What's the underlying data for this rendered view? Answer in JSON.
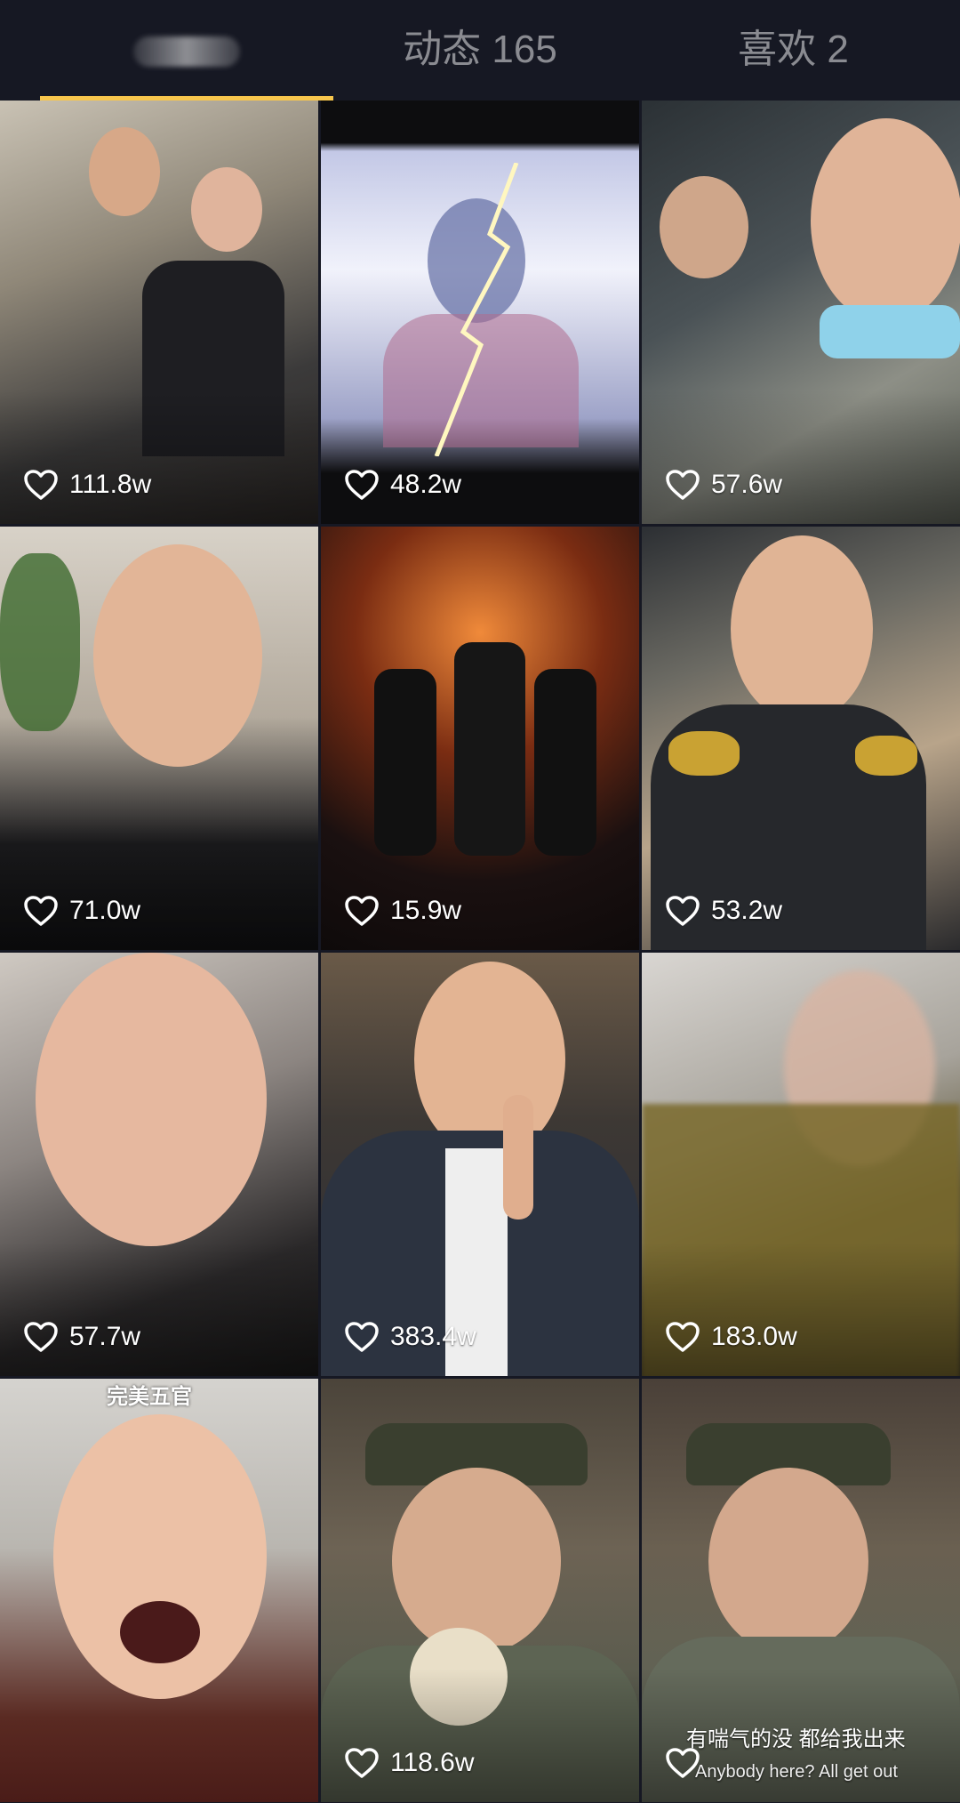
{
  "tabs": [
    {
      "label": "",
      "active": true
    },
    {
      "label": "动态 165",
      "active": false
    },
    {
      "label": "喜欢 2",
      "active": false
    }
  ],
  "colors": {
    "background": "#161823",
    "indicator": "#f7c64c",
    "inactive_tab": "#8a8b91"
  },
  "icons": {
    "like": "heart-outline-icon"
  },
  "videos": [
    {
      "likes": "111.8w"
    },
    {
      "likes": "48.2w"
    },
    {
      "likes": "57.6w"
    },
    {
      "likes": "71.0w"
    },
    {
      "likes": "15.9w"
    },
    {
      "likes": "53.2w"
    },
    {
      "likes": "57.7w"
    },
    {
      "likes": "383.4w"
    },
    {
      "likes": "183.0w"
    },
    {
      "likes": "",
      "top_caption": "完美五官"
    },
    {
      "likes": "118.6w"
    },
    {
      "likes": "",
      "caption": "有喘气的没 都给我出来",
      "caption_en": "Anybody here? All get out"
    }
  ]
}
